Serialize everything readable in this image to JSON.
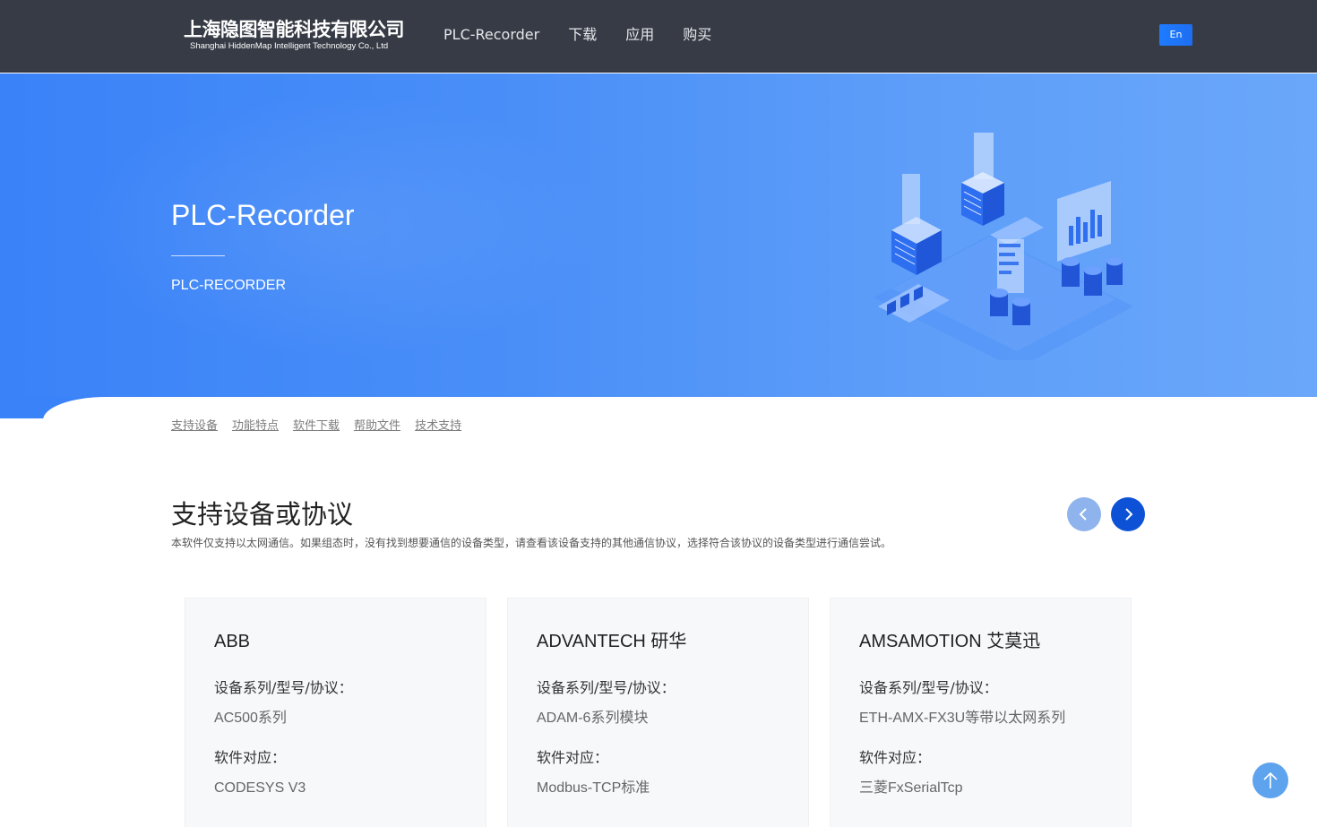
{
  "header": {
    "logo_cn": "上海隐图智能科技有限公司",
    "logo_en": "Shanghai HiddenMap Intelligent Technology Co., Ltd",
    "nav": [
      "PLC-Recorder",
      "下载",
      "应用",
      "购买"
    ],
    "lang_label": "En"
  },
  "banner": {
    "title": "PLC-Recorder",
    "subtitle": "PLC-RECORDER",
    "illustration_icon": "server-isometric-illustration"
  },
  "subnav": [
    "支持设备",
    "功能特点",
    "软件下载",
    "帮助文件",
    "技术支持"
  ],
  "section": {
    "title": "支持设备或协议",
    "description": "本软件仅支持以太网通信。如果组态时，没有找到想要通信的设备类型，请查看该设备支持的其他通信协议，选择符合该协议的设备类型进行通信尝试。",
    "prev_icon": "chevron-left-icon",
    "next_icon": "chevron-right-icon"
  },
  "cards": [
    {
      "name": "ABB",
      "label1": "设备系列/型号/协议：",
      "value1": "AC500系列",
      "label2": "软件对应：",
      "value2": "CODESYS V3"
    },
    {
      "name": "ADVANTECH 研华",
      "label1": "设备系列/型号/协议：",
      "value1": "ADAM-6系列模块",
      "label2": "软件对应：",
      "value2": "Modbus-TCP标准"
    },
    {
      "name": "AMSAMOTION 艾莫迅",
      "label1": "设备系列/型号/协议：",
      "value1": "ETH-AMX-FX3U等带以太网系列",
      "label2": "软件对应：",
      "value2": "三菱FxSerialTcp"
    }
  ],
  "back_to_top_icon": "arrow-up-icon",
  "colors": {
    "header_bg": "#373b45",
    "banner_blue": "#3a82f8",
    "accent": "#0d52d6",
    "card_bg": "#f7f8fa"
  }
}
